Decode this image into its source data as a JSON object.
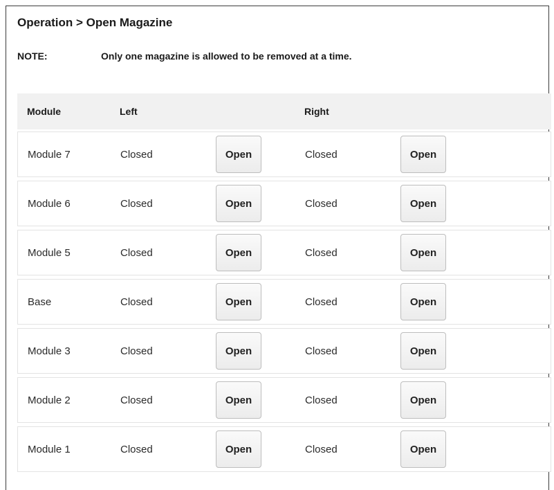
{
  "header": {
    "breadcrumb": "Operation > Open Magazine"
  },
  "note": {
    "label": "NOTE:",
    "text": "Only one magazine is allowed to be removed at a time."
  },
  "table": {
    "columns": {
      "module": "Module",
      "left": "Left",
      "right": "Right"
    },
    "rows": [
      {
        "module": "Module 7",
        "left_status": "Closed",
        "left_button": "Open",
        "right_status": "Closed",
        "right_button": "Open"
      },
      {
        "module": "Module 6",
        "left_status": "Closed",
        "left_button": "Open",
        "right_status": "Closed",
        "right_button": "Open"
      },
      {
        "module": "Module 5",
        "left_status": "Closed",
        "left_button": "Open",
        "right_status": "Closed",
        "right_button": "Open"
      },
      {
        "module": "Base",
        "left_status": "Closed",
        "left_button": "Open",
        "right_status": "Closed",
        "right_button": "Open"
      },
      {
        "module": "Module 3",
        "left_status": "Closed",
        "left_button": "Open",
        "right_status": "Closed",
        "right_button": "Open"
      },
      {
        "module": "Module 2",
        "left_status": "Closed",
        "left_button": "Open",
        "right_status": "Closed",
        "right_button": "Open"
      },
      {
        "module": "Module 1",
        "left_status": "Closed",
        "left_button": "Open",
        "right_status": "Closed",
        "right_button": "Open"
      }
    ]
  }
}
